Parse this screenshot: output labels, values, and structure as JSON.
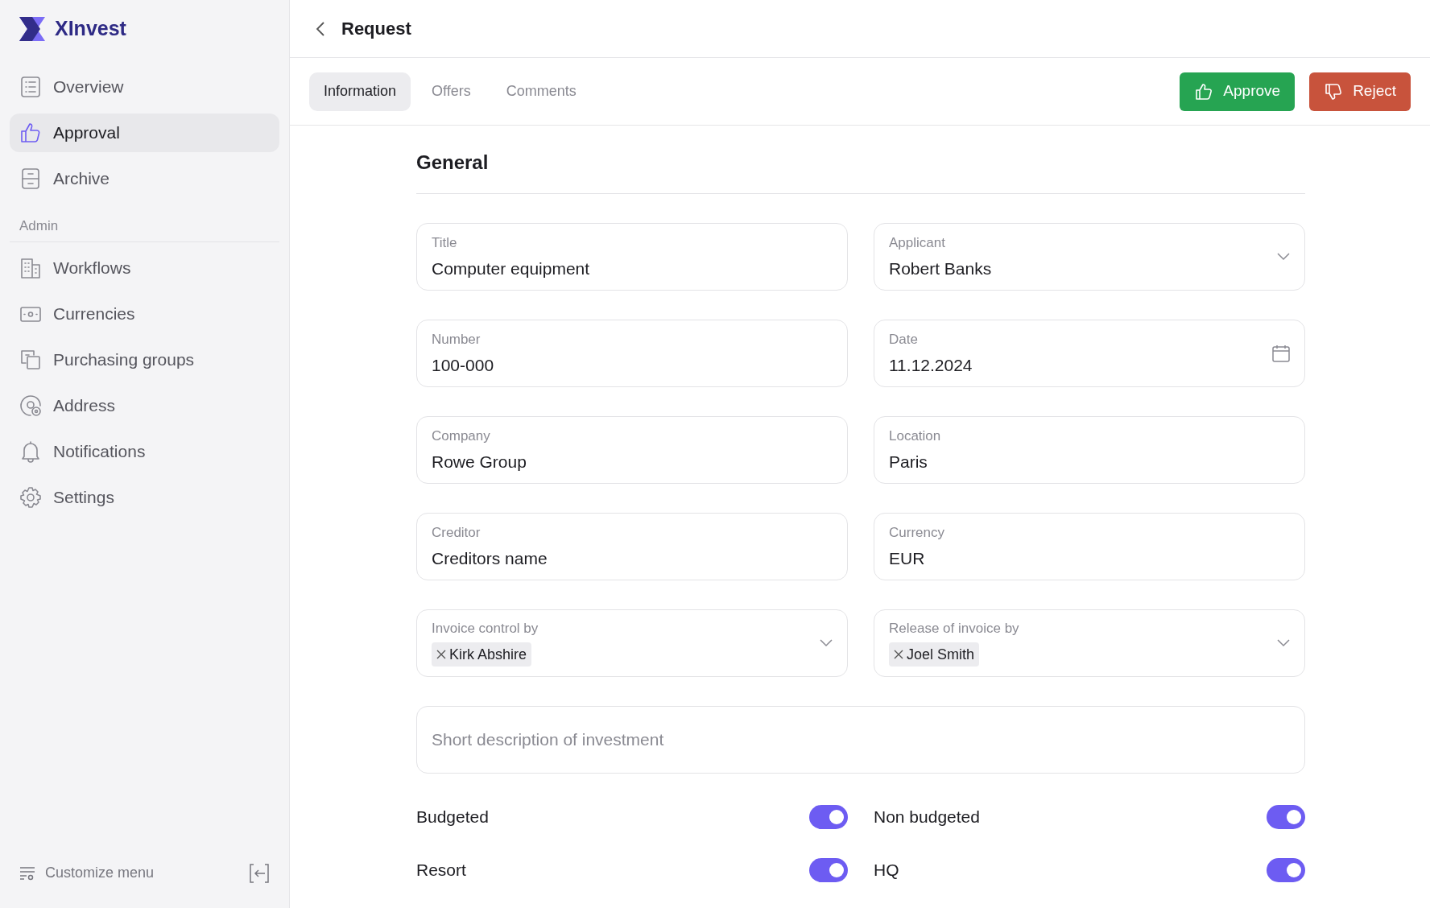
{
  "brand": {
    "name": "XInvest"
  },
  "sidebar": {
    "items": [
      {
        "label": "Overview",
        "selected": false
      },
      {
        "label": "Approval",
        "selected": true
      },
      {
        "label": "Archive",
        "selected": false
      }
    ],
    "section_title": "Admin",
    "admin_items": [
      {
        "label": "Workflows",
        "selected": false
      },
      {
        "label": "Currencies",
        "selected": false
      },
      {
        "label": "Purchasing groups",
        "selected": false
      },
      {
        "label": "Address",
        "selected": false
      },
      {
        "label": "Notifications",
        "selected": false
      },
      {
        "label": "Settings",
        "selected": false
      }
    ],
    "footer": {
      "label": "Customize menu"
    }
  },
  "header": {
    "title": "Request"
  },
  "tabs": [
    {
      "label": "Information",
      "selected": true
    },
    {
      "label": "Offers",
      "selected": false
    },
    {
      "label": "Comments",
      "selected": false
    }
  ],
  "actions": [
    {
      "label": "Approve",
      "kind": "approve"
    },
    {
      "label": "Reject",
      "kind": "reject"
    }
  ],
  "section": {
    "title": "General"
  },
  "fields": [
    {
      "label": "Title",
      "kind": "text",
      "value": "Computer equipment"
    },
    {
      "label": "Applicant",
      "kind": "select",
      "value": "Robert Banks"
    },
    {
      "label": "Number",
      "kind": "text",
      "value": "100-000"
    },
    {
      "label": "Date",
      "kind": "date",
      "value": "11.12.2024"
    },
    {
      "label": "Company",
      "kind": "text",
      "value": "Rowe Group"
    },
    {
      "label": "Location",
      "kind": "text",
      "value": "Paris"
    },
    {
      "label": "Creditor",
      "kind": "text",
      "value": "Creditors name"
    },
    {
      "label": "Currency",
      "kind": "text",
      "value": "EUR"
    },
    {
      "label": "Invoice control by",
      "kind": "tags",
      "tags": [
        "Kirk Abshire"
      ]
    },
    {
      "label": "Release of invoice by",
      "kind": "tags",
      "tags": [
        "Joel Smith"
      ]
    }
  ],
  "description": {
    "placeholder": "Short description of investment"
  },
  "toggles": [
    {
      "label": "Budgeted",
      "on": true
    },
    {
      "label": "Non budgeted",
      "on": true
    },
    {
      "label": "Resort",
      "on": true
    },
    {
      "label": "HQ",
      "on": true
    }
  ]
}
